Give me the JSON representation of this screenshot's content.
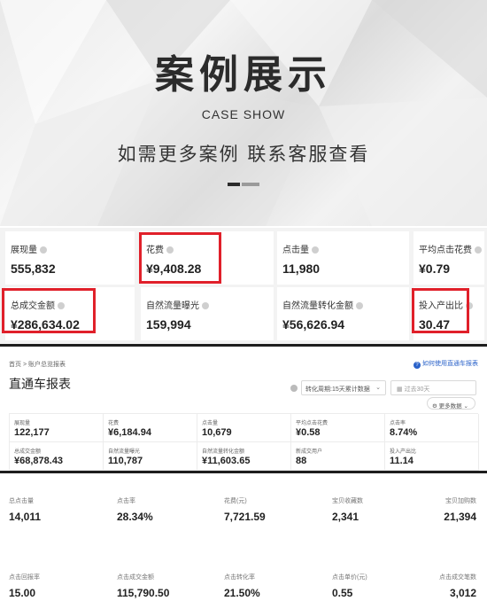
{
  "hero": {
    "title": "案例展示",
    "subtitle": "CASE SHOW",
    "description": "如需更多案例 联系客服查看"
  },
  "summary_metrics": [
    {
      "label": "展现量",
      "value": "555,832",
      "highlighted": false
    },
    {
      "label": "花费",
      "value": "¥9,408.28",
      "highlighted": true
    },
    {
      "label": "点击量",
      "value": "11,980",
      "highlighted": false
    },
    {
      "label": "平均点击花费",
      "value": "¥0.79",
      "highlighted": false
    },
    {
      "label": "总成交金额",
      "value": "¥286,634.02",
      "highlighted": true
    },
    {
      "label": "自然流量曝光",
      "value": "159,994",
      "highlighted": false
    },
    {
      "label": "自然流量转化金额",
      "value": "¥56,626.94",
      "highlighted": false
    },
    {
      "label": "投入产出比",
      "value": "30.47",
      "highlighted": true
    }
  ],
  "report": {
    "breadcrumb": "首页  >  账户总览报表",
    "help_link": "如何使用直通车报表",
    "title": "直通车报表",
    "select_value": "转化周期:15天累计数据",
    "date_placeholder": "过去30天",
    "more_button": "更多数据",
    "metrics": [
      {
        "label": "展现量",
        "value": "122,177"
      },
      {
        "label": "花费",
        "value": "¥6,184.94"
      },
      {
        "label": "点击量",
        "value": "10,679"
      },
      {
        "label": "平均点击花费",
        "value": "¥0.58"
      },
      {
        "label": "点击率",
        "value": "8.74%"
      },
      {
        "label": "总成交金额",
        "value": "¥68,878.43"
      },
      {
        "label": "自然流量曝光",
        "value": "110,787"
      },
      {
        "label": "自然流量转化金额",
        "value": "¥11,603.65"
      },
      {
        "label": "新成交用户",
        "value": "88"
      },
      {
        "label": "投入产出比",
        "value": "11.14"
      }
    ]
  },
  "bottom_metrics": [
    {
      "label": "总点击量",
      "value": "14,011"
    },
    {
      "label": "点击率",
      "value": "28.34%"
    },
    {
      "label": "花费(元)",
      "value": "7,721.59"
    },
    {
      "label": "宝贝收藏数",
      "value": "2,341"
    },
    {
      "label": "宝贝加购数",
      "value": "21,394"
    },
    {
      "label": "点击回报率",
      "value": "15.00"
    },
    {
      "label": "点击成交金额",
      "value": "115,790.50"
    },
    {
      "label": "点击转化率",
      "value": "21.50%"
    },
    {
      "label": "点击单价(元)",
      "value": "0.55"
    },
    {
      "label": "点击成交笔数",
      "value": "3,012"
    }
  ],
  "colors": {
    "highlight_border": "#e0202a",
    "link_blue": "#2a62c9",
    "divider": "#1e1e1e"
  }
}
